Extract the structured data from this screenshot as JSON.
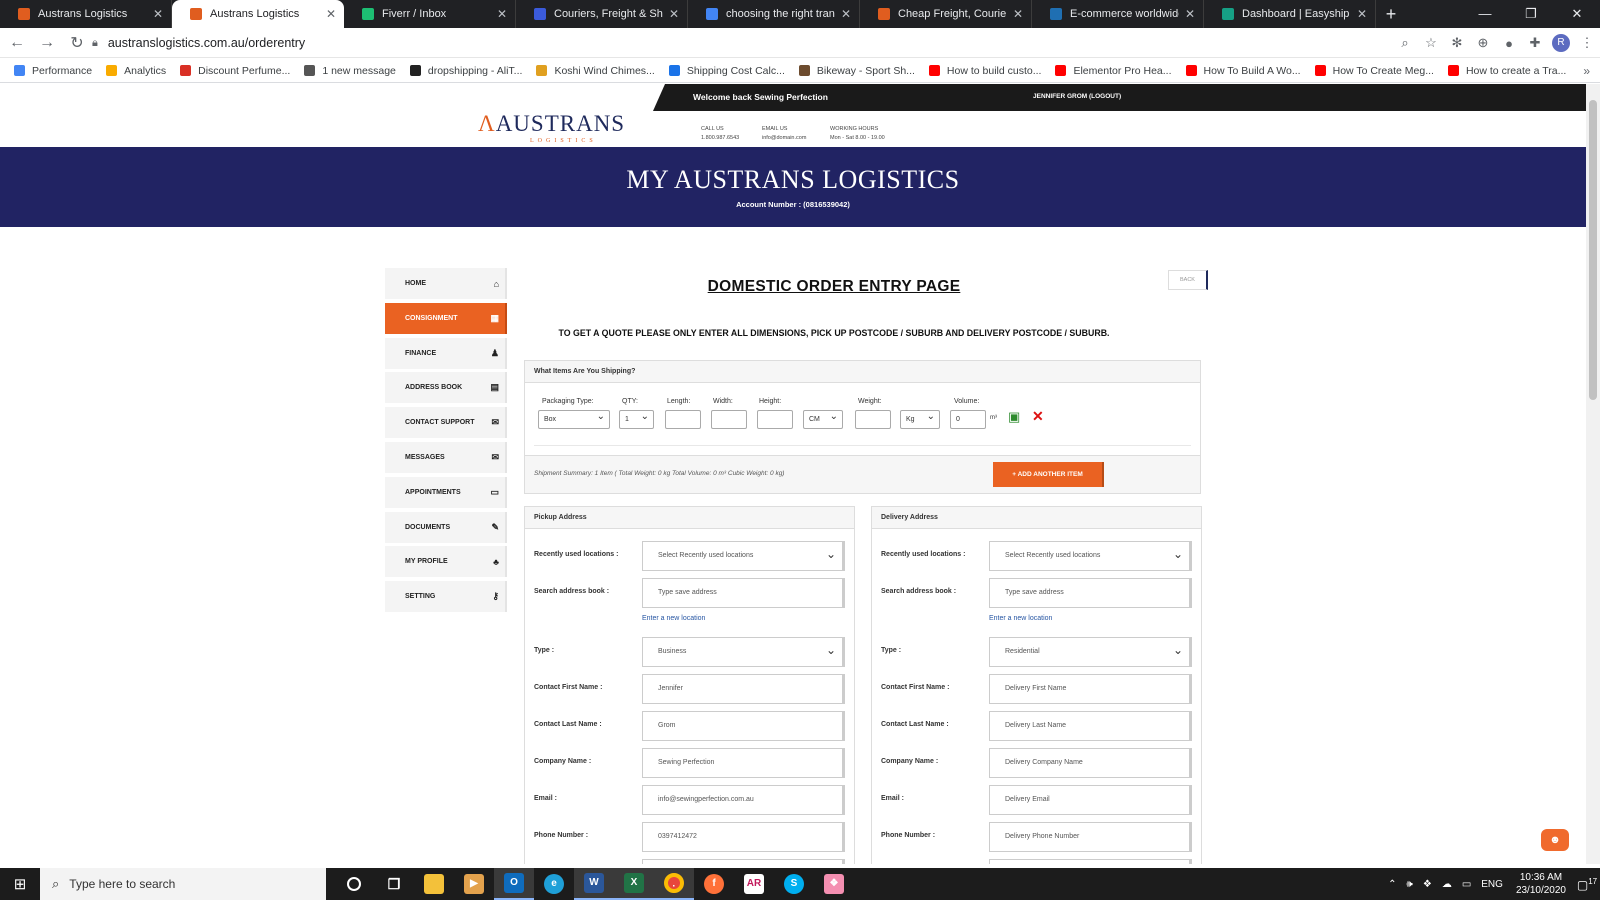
{
  "browser": {
    "tabs": [
      {
        "label": "Austrans Logistics",
        "color": "#e05d1f",
        "active": false
      },
      {
        "label": "Austrans Logistics",
        "color": "#e05d1f",
        "active": true
      },
      {
        "label": "Fiverr / Inbox",
        "color": "#1dbf73",
        "active": false
      },
      {
        "label": "Couriers, Freight & Shipping",
        "color": "#3b5bdb",
        "active": false
      },
      {
        "label": "choosing the right transport",
        "color": "#4285f4",
        "active": false
      },
      {
        "label": "Cheap Freight, Courier Deliv",
        "color": "#e05d1f",
        "active": false
      },
      {
        "label": "E-commerce worldwide - Sh",
        "color": "#1f6fb2",
        "active": false
      },
      {
        "label": "Dashboard | Easyship",
        "color": "#16a085",
        "active": false
      }
    ],
    "url": "austranslogistics.com.au/orderentry",
    "profile_initial": "R",
    "bookmarks": [
      {
        "label": "Performance",
        "color": "#4285f4"
      },
      {
        "label": "Analytics",
        "color": "#f9ab00"
      },
      {
        "label": "Discount Perfume...",
        "color": "#d93025"
      },
      {
        "label": "1 new message",
        "color": "#555555"
      },
      {
        "label": "dropshipping - AliT...",
        "color": "#222222"
      },
      {
        "label": "Koshi Wind Chimes...",
        "color": "#e0a020"
      },
      {
        "label": "Shipping Cost Calc...",
        "color": "#1a73e8"
      },
      {
        "label": "Bikeway - Sport Sh...",
        "color": "#6d4c2f"
      },
      {
        "label": "How to build custo...",
        "color": "#ff0000"
      },
      {
        "label": "Elementor Pro Hea...",
        "color": "#ff0000"
      },
      {
        "label": "How To Build A Wo...",
        "color": "#ff0000"
      },
      {
        "label": "How To Create Meg...",
        "color": "#ff0000"
      },
      {
        "label": "How to create a Tra...",
        "color": "#ff0000"
      }
    ]
  },
  "site": {
    "welcome": "Welcome back Sewing Perfection",
    "logout": "JENNIFER GROM (LOGOUT)",
    "logo_main": "AUSTRANS",
    "logo_sub": "LOGISTICS",
    "call_label": "CALL US",
    "call_value": "1.800.987.6543",
    "email_label": "EMAIL US",
    "email_value": "info@domain.com",
    "hours_label": "WORKING HOURS",
    "hours_value": "Mon - Sat 8.00 - 19.00",
    "banner_title": "MY AUSTRANS LOGISTICS",
    "account": "Account Number : (0816539042)",
    "accent": "#ea6222",
    "navy": "#212363"
  },
  "sidebar": {
    "items": [
      {
        "label": "HOME",
        "icon": "home-icon",
        "glyph": "⌂"
      },
      {
        "label": "CONSIGNMENT",
        "icon": "calendar-icon",
        "glyph": "▦"
      },
      {
        "label": "FINANCE",
        "icon": "user-icon",
        "glyph": "♟"
      },
      {
        "label": "ADDRESS BOOK",
        "icon": "address-book-icon",
        "glyph": "▤"
      },
      {
        "label": "CONTACT SUPPORT",
        "icon": "envelope-icon",
        "glyph": "✉"
      },
      {
        "label": "MESSAGES",
        "icon": "envelope-icon",
        "glyph": "✉"
      },
      {
        "label": "APPOINTMENTS",
        "icon": "window-icon",
        "glyph": "▭"
      },
      {
        "label": "DOCUMENTS",
        "icon": "edit-icon",
        "glyph": "✎"
      },
      {
        "label": "MY PROFILE",
        "icon": "users-icon",
        "glyph": "♣"
      },
      {
        "label": "SETTING",
        "icon": "key-icon",
        "glyph": "⚷"
      }
    ],
    "active_index": 1
  },
  "main": {
    "back": "BACK",
    "title": "DOMESTIC ORDER ENTRY PAGE",
    "note": "TO GET A QUOTE PLEASE ONLY ENTER ALL DIMENSIONS, PICK UP POSTCODE / SUBURB AND DELIVERY POSTCODE / SUBURB.",
    "items_header": "What Items Are You Shipping?",
    "fields": {
      "packaging_label": "Packaging Type:",
      "packaging_value": "Box",
      "qty_label": "QTY:",
      "qty_value": "1",
      "length_label": "Length:",
      "width_label": "Width:",
      "height_label": "Height:",
      "unit_value": "CM",
      "weight_label": "Weight:",
      "weight_unit": "Kg",
      "volume_label": "Volume:",
      "volume_value": "0",
      "volume_unit": "m³"
    },
    "summary": "Shipment Summary: 1 Item ( Total Weight: 0 kg Total Volume: 0 m³ Cubic Weight: 0 kg)",
    "add_item": "+ ADD ANOTHER ITEM"
  },
  "pickup": {
    "header": "Pickup Address",
    "recent_label": "Recently used locations :",
    "recent_value": "Select Recently used locations",
    "search_label": "Search address book :",
    "search_placeholder": "Type save address",
    "new_location": "Enter a new location",
    "type_label": "Type :",
    "type_value": "Business",
    "first_label": "Contact First Name :",
    "first_value": "Jennifer",
    "last_label": "Contact Last Name :",
    "last_value": "Grom",
    "company_label": "Company Name :",
    "company_value": "Sewing Perfection",
    "email_label": "Email :",
    "email_value": "info@sewingperfection.com.au",
    "phone_label": "Phone Number :",
    "phone_value": "0397412472"
  },
  "delivery": {
    "header": "Delivery Address",
    "recent_label": "Recently used locations :",
    "recent_value": "Select Recently used locations",
    "search_label": "Search address book :",
    "search_placeholder": "Type save address",
    "new_location": "Enter a new location",
    "type_label": "Type :",
    "type_value": "Residential",
    "first_label": "Contact First Name :",
    "first_value": "Delivery First Name",
    "last_label": "Contact Last Name :",
    "last_value": "Delivery Last Name",
    "company_label": "Company Name :",
    "company_value": "Delivery Company Name",
    "email_label": "Email :",
    "email_value": "Delivery Email",
    "phone_label": "Phone Number :",
    "phone_value": "Delivery Phone Number"
  },
  "taskbar": {
    "search": "Type here to search",
    "lang": "ENG",
    "time": "10:36 AM",
    "date": "23/10/2020",
    "notifications": "17"
  }
}
